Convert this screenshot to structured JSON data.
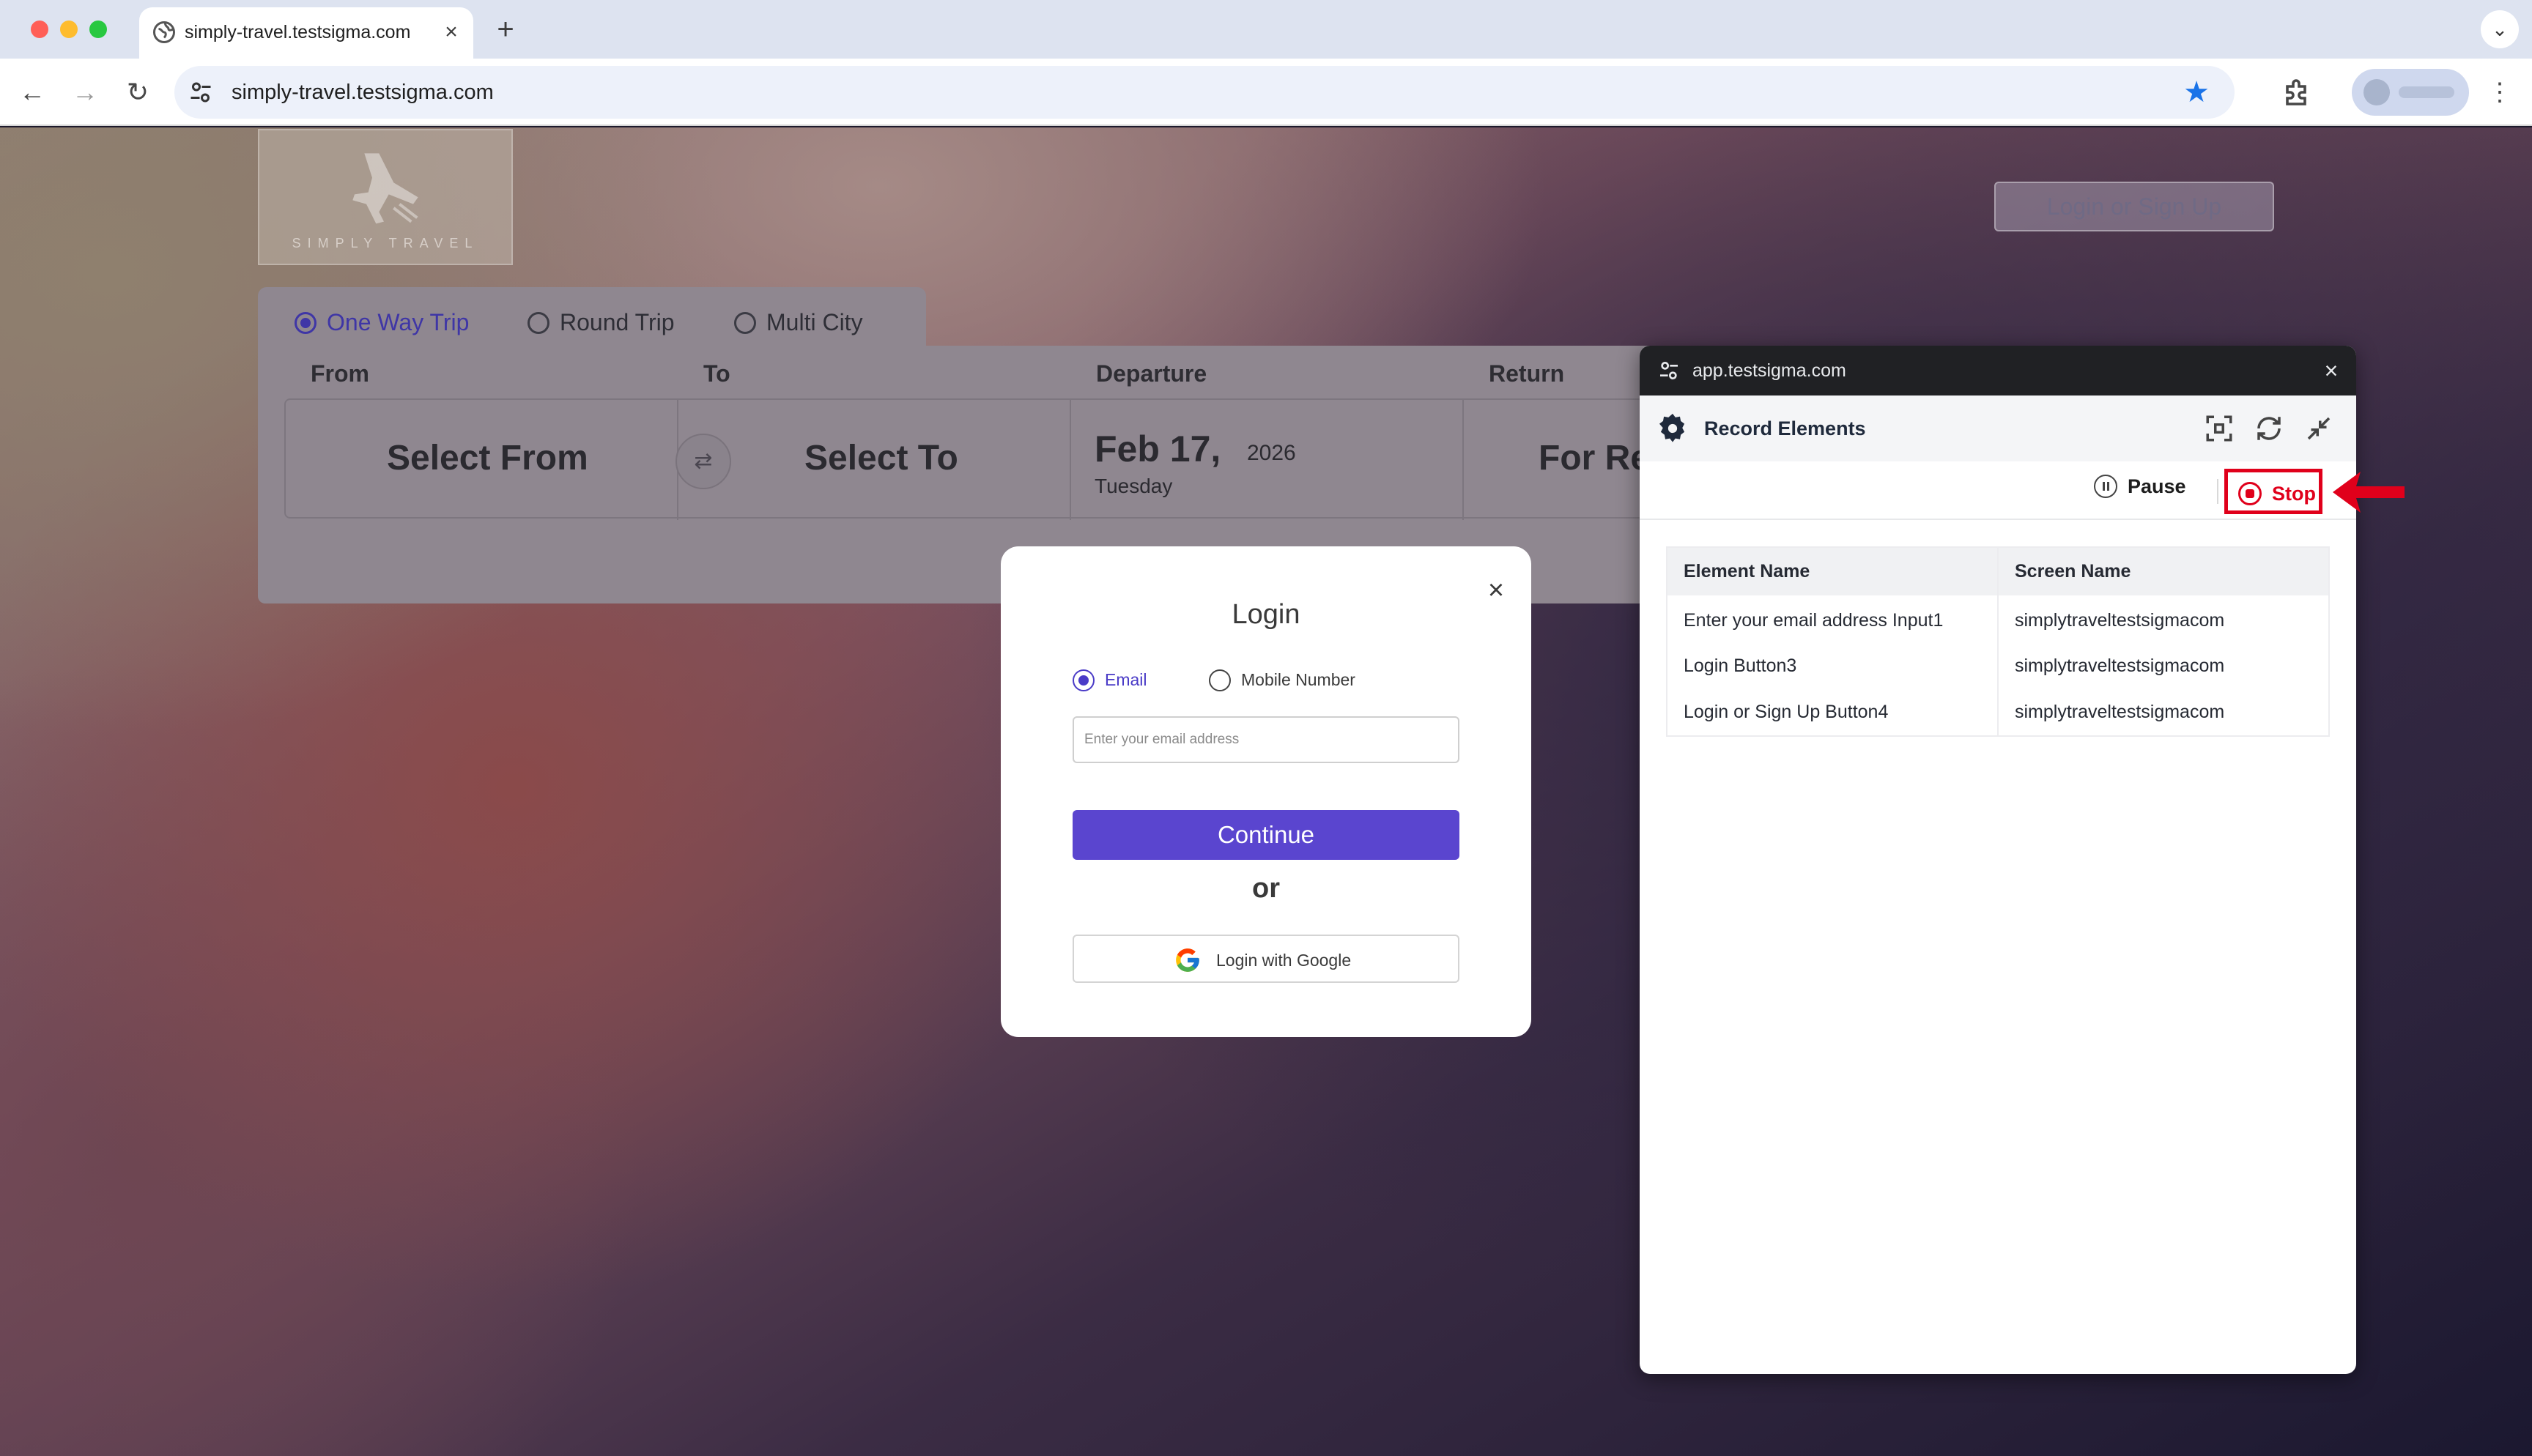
{
  "browser": {
    "tab_title": "simply-travel.testsigma.com",
    "new_tab": "+",
    "tab_menu": "⌄",
    "url": "simply-travel.testsigma.com",
    "back": "←",
    "forward": "→",
    "reload": "↻",
    "star": "★",
    "menu": "⋮",
    "tab_close": "×"
  },
  "site": {
    "logo_text": "SIMPLY TRAVEL",
    "login_signup": "Login or Sign Up",
    "trip_types": [
      "One Way Trip",
      "Round Trip",
      "Multi City"
    ],
    "selected_trip": "One Way Trip",
    "fields": {
      "from_label": "From",
      "to_label": "To",
      "departure_label": "Departure",
      "return_label": "Return",
      "from_value": "Select From",
      "to_value": "Select To",
      "swap": "⇄",
      "departure_date": "Feb 17,",
      "departure_year": "2026",
      "departure_day": "Tuesday",
      "return_value": "For Re"
    }
  },
  "login_modal": {
    "title": "Login",
    "close": "×",
    "email_option": "Email",
    "mobile_option": "Mobile Number",
    "email_placeholder": "Enter your email address",
    "continue": "Continue",
    "or": "or",
    "google": "Login with Google"
  },
  "recorder": {
    "domain": "app.testsigma.com",
    "close": "×",
    "title": "Record Elements",
    "pause": "Pause",
    "stop": "Stop",
    "columns": [
      "Element Name",
      "Screen Name"
    ],
    "rows": [
      {
        "element": "Enter your email address Input1",
        "screen": "simplytraveltestsigmacom"
      },
      {
        "element": "Login Button3",
        "screen": "simplytraveltestsigmacom"
      },
      {
        "element": "Login or Sign Up Button4",
        "screen": "simplytraveltestsigmacom"
      }
    ]
  },
  "colors": {
    "accent": "#5a45cf",
    "stop_red": "#e0001b",
    "chrome_blue": "#1a73e8"
  }
}
